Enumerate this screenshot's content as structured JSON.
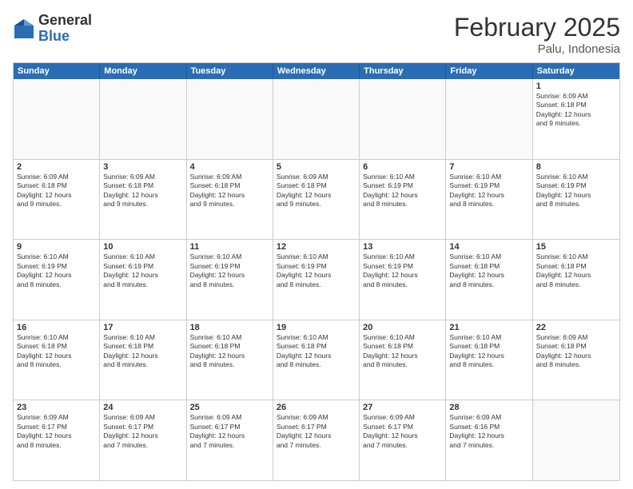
{
  "logo": {
    "general": "General",
    "blue": "Blue"
  },
  "header": {
    "month": "February 2025",
    "location": "Palu, Indonesia"
  },
  "days": [
    "Sunday",
    "Monday",
    "Tuesday",
    "Wednesday",
    "Thursday",
    "Friday",
    "Saturday"
  ],
  "weeks": [
    [
      {
        "day": "",
        "info": ""
      },
      {
        "day": "",
        "info": ""
      },
      {
        "day": "",
        "info": ""
      },
      {
        "day": "",
        "info": ""
      },
      {
        "day": "",
        "info": ""
      },
      {
        "day": "",
        "info": ""
      },
      {
        "day": "1",
        "info": "Sunrise: 6:09 AM\nSunset: 6:18 PM\nDaylight: 12 hours\nand 9 minutes."
      }
    ],
    [
      {
        "day": "2",
        "info": "Sunrise: 6:09 AM\nSunset: 6:18 PM\nDaylight: 12 hours\nand 9 minutes."
      },
      {
        "day": "3",
        "info": "Sunrise: 6:09 AM\nSunset: 6:18 PM\nDaylight: 12 hours\nand 9 minutes."
      },
      {
        "day": "4",
        "info": "Sunrise: 6:09 AM\nSunset: 6:18 PM\nDaylight: 12 hours\nand 9 minutes."
      },
      {
        "day": "5",
        "info": "Sunrise: 6:09 AM\nSunset: 6:18 PM\nDaylight: 12 hours\nand 9 minutes."
      },
      {
        "day": "6",
        "info": "Sunrise: 6:10 AM\nSunset: 6:19 PM\nDaylight: 12 hours\nand 8 minutes."
      },
      {
        "day": "7",
        "info": "Sunrise: 6:10 AM\nSunset: 6:19 PM\nDaylight: 12 hours\nand 8 minutes."
      },
      {
        "day": "8",
        "info": "Sunrise: 6:10 AM\nSunset: 6:19 PM\nDaylight: 12 hours\nand 8 minutes."
      }
    ],
    [
      {
        "day": "9",
        "info": "Sunrise: 6:10 AM\nSunset: 6:19 PM\nDaylight: 12 hours\nand 8 minutes."
      },
      {
        "day": "10",
        "info": "Sunrise: 6:10 AM\nSunset: 6:19 PM\nDaylight: 12 hours\nand 8 minutes."
      },
      {
        "day": "11",
        "info": "Sunrise: 6:10 AM\nSunset: 6:19 PM\nDaylight: 12 hours\nand 8 minutes."
      },
      {
        "day": "12",
        "info": "Sunrise: 6:10 AM\nSunset: 6:19 PM\nDaylight: 12 hours\nand 8 minutes."
      },
      {
        "day": "13",
        "info": "Sunrise: 6:10 AM\nSunset: 6:19 PM\nDaylight: 12 hours\nand 8 minutes."
      },
      {
        "day": "14",
        "info": "Sunrise: 6:10 AM\nSunset: 6:18 PM\nDaylight: 12 hours\nand 8 minutes."
      },
      {
        "day": "15",
        "info": "Sunrise: 6:10 AM\nSunset: 6:18 PM\nDaylight: 12 hours\nand 8 minutes."
      }
    ],
    [
      {
        "day": "16",
        "info": "Sunrise: 6:10 AM\nSunset: 6:18 PM\nDaylight: 12 hours\nand 8 minutes."
      },
      {
        "day": "17",
        "info": "Sunrise: 6:10 AM\nSunset: 6:18 PM\nDaylight: 12 hours\nand 8 minutes."
      },
      {
        "day": "18",
        "info": "Sunrise: 6:10 AM\nSunset: 6:18 PM\nDaylight: 12 hours\nand 8 minutes."
      },
      {
        "day": "19",
        "info": "Sunrise: 6:10 AM\nSunset: 6:18 PM\nDaylight: 12 hours\nand 8 minutes."
      },
      {
        "day": "20",
        "info": "Sunrise: 6:10 AM\nSunset: 6:18 PM\nDaylight: 12 hours\nand 8 minutes."
      },
      {
        "day": "21",
        "info": "Sunrise: 6:10 AM\nSunset: 6:18 PM\nDaylight: 12 hours\nand 8 minutes."
      },
      {
        "day": "22",
        "info": "Sunrise: 6:09 AM\nSunset: 6:18 PM\nDaylight: 12 hours\nand 8 minutes."
      }
    ],
    [
      {
        "day": "23",
        "info": "Sunrise: 6:09 AM\nSunset: 6:17 PM\nDaylight: 12 hours\nand 8 minutes."
      },
      {
        "day": "24",
        "info": "Sunrise: 6:09 AM\nSunset: 6:17 PM\nDaylight: 12 hours\nand 7 minutes."
      },
      {
        "day": "25",
        "info": "Sunrise: 6:09 AM\nSunset: 6:17 PM\nDaylight: 12 hours\nand 7 minutes."
      },
      {
        "day": "26",
        "info": "Sunrise: 6:09 AM\nSunset: 6:17 PM\nDaylight: 12 hours\nand 7 minutes."
      },
      {
        "day": "27",
        "info": "Sunrise: 6:09 AM\nSunset: 6:17 PM\nDaylight: 12 hours\nand 7 minutes."
      },
      {
        "day": "28",
        "info": "Sunrise: 6:09 AM\nSunset: 6:16 PM\nDaylight: 12 hours\nand 7 minutes."
      },
      {
        "day": "",
        "info": ""
      }
    ]
  ]
}
